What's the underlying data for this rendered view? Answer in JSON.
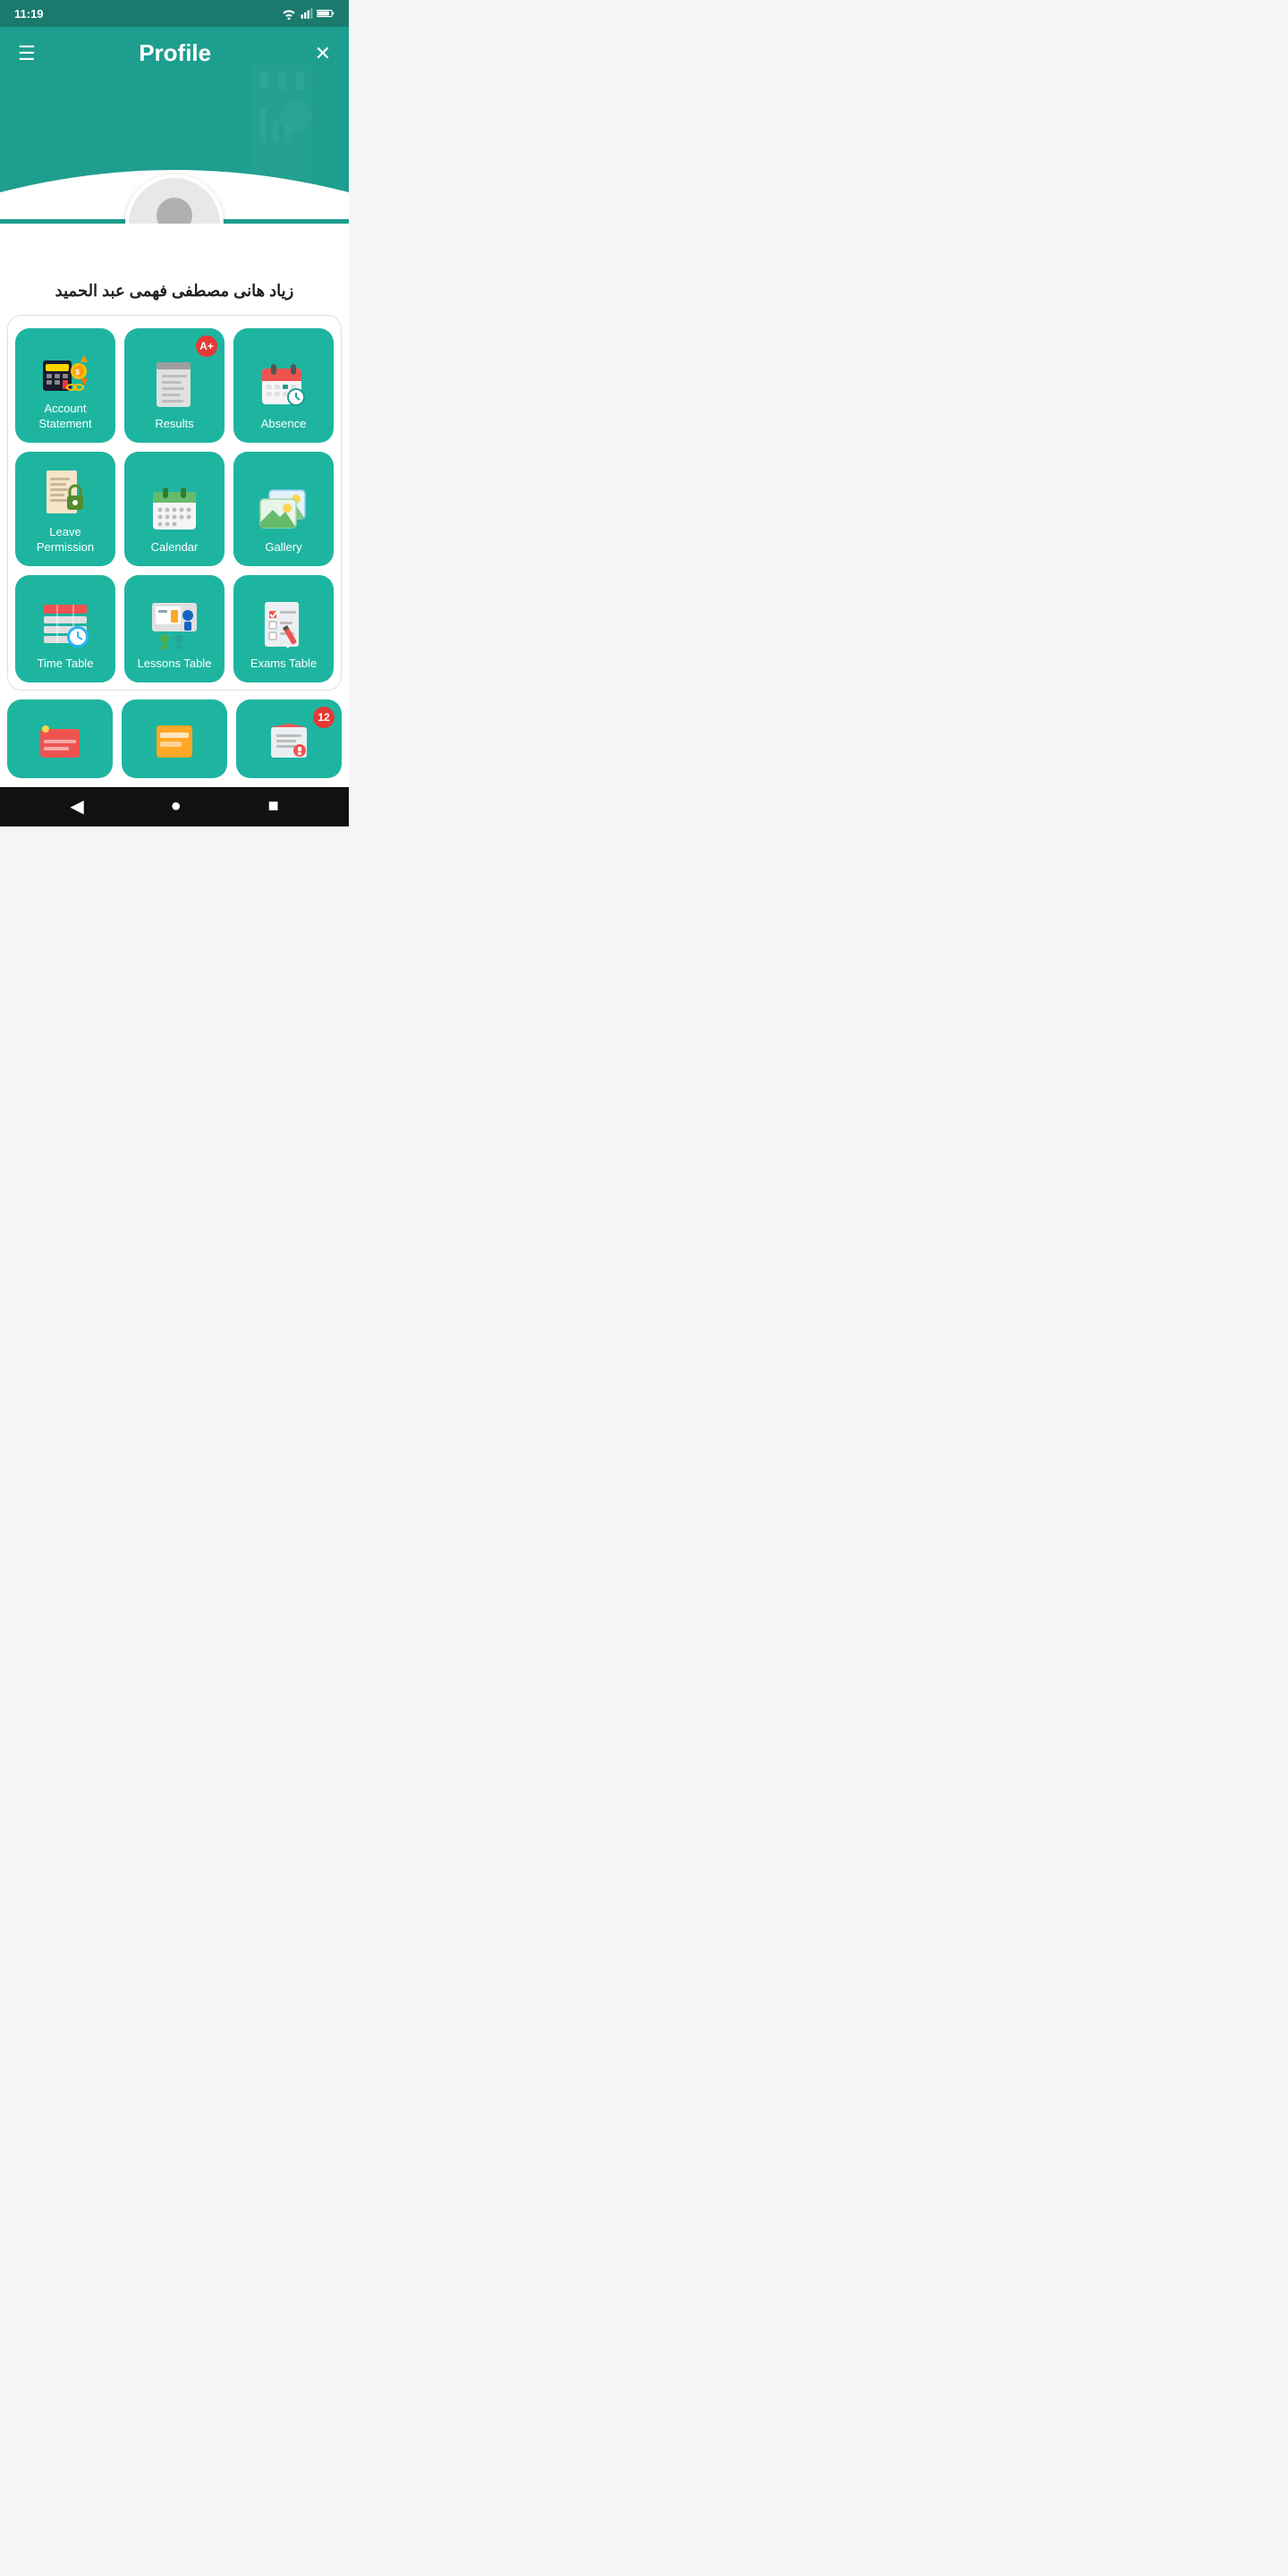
{
  "status": {
    "time": "11:19"
  },
  "header": {
    "menu_label": "☰",
    "title": "Profile",
    "close_label": "✕"
  },
  "user": {
    "name": "زياد هانى مصطفى فهمى عبد الحميد"
  },
  "menu_cards": [
    {
      "id": "account-statement",
      "label": "Account\nStatement",
      "badge": null
    },
    {
      "id": "results",
      "label": "Results",
      "badge": "A+"
    },
    {
      "id": "absence",
      "label": "Absence",
      "badge": null
    },
    {
      "id": "leave-permission",
      "label": "Leave\nPermission",
      "badge": null
    },
    {
      "id": "calendar",
      "label": "Calendar",
      "badge": null
    },
    {
      "id": "gallery",
      "label": "Gallery",
      "badge": null
    },
    {
      "id": "time-table",
      "label": "Time Table",
      "badge": null
    },
    {
      "id": "lessons-table",
      "label": "Lessons Table",
      "badge": null
    },
    {
      "id": "exams-table",
      "label": "Exams Table",
      "badge": null
    }
  ],
  "partial_cards": [
    {
      "id": "partial-1",
      "badge": null
    },
    {
      "id": "partial-2",
      "badge": null
    },
    {
      "id": "partial-3",
      "badge": "12"
    }
  ],
  "bottom_nav": {
    "back": "◀",
    "home": "●",
    "recent": "■"
  },
  "colors": {
    "teal_dark": "#1a7a6e",
    "teal_main": "#1e9e8e",
    "teal_card": "#1eb5a0",
    "red_badge": "#e53935"
  }
}
